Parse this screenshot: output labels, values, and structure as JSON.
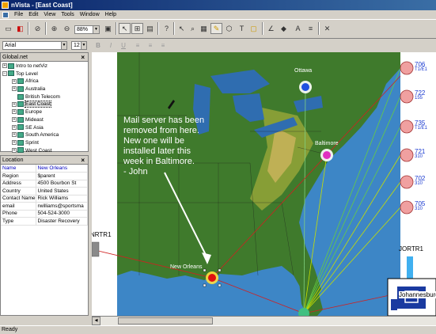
{
  "window": {
    "title": "nVista - [East Coast]"
  },
  "menu": [
    "File",
    "Edit",
    "View",
    "Tools",
    "Window",
    "Help"
  ],
  "toolbar": {
    "zoom": "88%"
  },
  "format_bar": {
    "font": "Arial",
    "size": "12",
    "bold": "B",
    "italic": "I",
    "underline": "U"
  },
  "global_panel": {
    "title": "Global.net",
    "items": [
      {
        "label": "Intro to netViz",
        "indent": 0,
        "exp": "+"
      },
      {
        "label": "Top Level",
        "indent": 0,
        "exp": "−"
      },
      {
        "label": "Africa",
        "indent": 1,
        "exp": "+"
      },
      {
        "label": "Australia",
        "indent": 1,
        "exp": "+"
      },
      {
        "label": "British Telecom",
        "indent": 1,
        "exp": ""
      },
      {
        "label": "East Coast",
        "indent": 1,
        "exp": "+",
        "selected": true
      },
      {
        "label": "Europe",
        "indent": 1,
        "exp": "+"
      },
      {
        "label": "Mideast",
        "indent": 1,
        "exp": "+"
      },
      {
        "label": "SE Asia",
        "indent": 1,
        "exp": "+"
      },
      {
        "label": "South America",
        "indent": 1,
        "exp": "+"
      },
      {
        "label": "Sprint",
        "indent": 1,
        "exp": "+"
      },
      {
        "label": "West Coast",
        "indent": 1,
        "exp": "+"
      }
    ]
  },
  "location_panel": {
    "title": "Location",
    "rows": [
      {
        "key": "Name",
        "value": "New Orleans"
      },
      {
        "key": "Region",
        "value": "$parent"
      },
      {
        "key": "Address",
        "value": "4500 Bourbon St"
      },
      {
        "key": "Country",
        "value": "United States"
      },
      {
        "key": "Contact Name",
        "value": "Rick Williams"
      },
      {
        "key": "email",
        "value": "rwilliams@sportsma"
      },
      {
        "key": "Phone",
        "value": "504-524-3000"
      },
      {
        "key": "Type",
        "value": "Disaster Recovery"
      }
    ]
  },
  "map": {
    "annotation": [
      "Mail server has been",
      "removed from here.",
      "New one will be",
      "installed later this",
      "week in Baltimore.",
      "- John"
    ],
    "city_labels": {
      "ottawa": "Ottawa",
      "baltimore": "Baltimore",
      "new_orleans": "New Orleans"
    },
    "left_router": "NRTR1",
    "right_router": "JORTR1",
    "right_router_sub": "Johannesburg",
    "circuits": [
      {
        "id": "706",
        "type": "T1/E1"
      },
      {
        "id": "722",
        "type": "155"
      },
      {
        "id": "735",
        "type": "T1/E1"
      },
      {
        "id": "721",
        "type": "310"
      },
      {
        "id": "702",
        "type": "310"
      },
      {
        "id": "705",
        "type": "310"
      }
    ]
  },
  "status": "Ready"
}
